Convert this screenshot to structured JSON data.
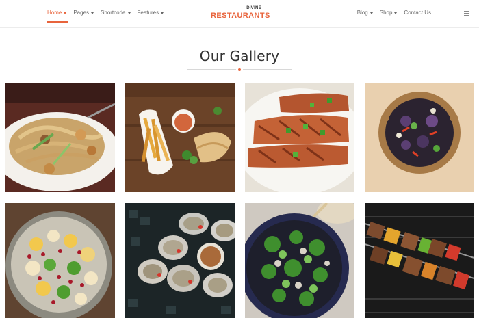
{
  "nav_left": [
    {
      "label": "Home",
      "active": true
    },
    {
      "label": "Pages",
      "active": false
    },
    {
      "label": "Shortcode",
      "active": false
    },
    {
      "label": "Features",
      "active": false
    }
  ],
  "logo": {
    "top": "DIVINE",
    "main": "RESTAURANTS"
  },
  "nav_right": [
    {
      "label": "Blog",
      "dropdown": true
    },
    {
      "label": "Shop",
      "dropdown": true
    },
    {
      "label": "Contact Us",
      "dropdown": false
    }
  ],
  "menu_icon": "hamburger-icon",
  "gallery": {
    "title": "Our Gallery",
    "accent_color": "#e8643c",
    "images": [
      {
        "name": "noodles-dish-image"
      },
      {
        "name": "fries-sandwich-image"
      },
      {
        "name": "grilled-chicken-image"
      },
      {
        "name": "salad-bowl-image"
      },
      {
        "name": "fruit-salad-image"
      },
      {
        "name": "oysters-image"
      },
      {
        "name": "green-salad-image"
      },
      {
        "name": "kebab-skewers-image"
      }
    ]
  }
}
